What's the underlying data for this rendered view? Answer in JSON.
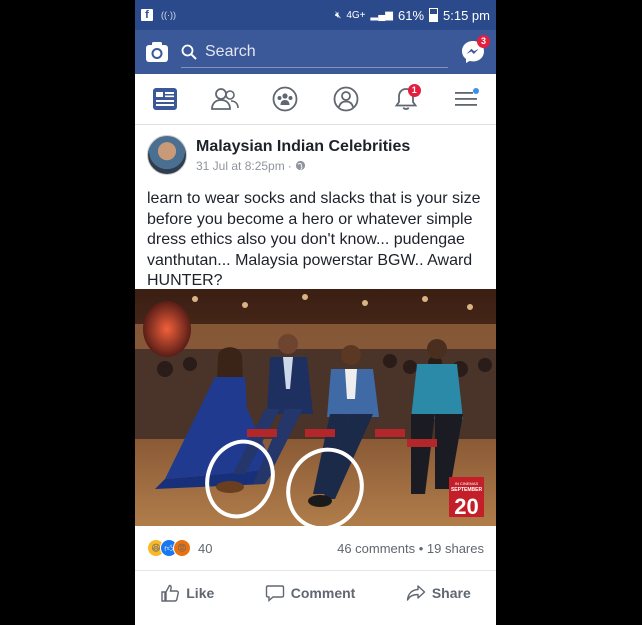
{
  "status_bar": {
    "network": "4G+",
    "battery": "61%",
    "time": "5:15 pm"
  },
  "topbar": {
    "search_placeholder": "Search",
    "messenger_badge": "3"
  },
  "nav": {
    "notifications_badge": "1"
  },
  "post": {
    "author": "Malaysian Indian Celebrities",
    "timestamp": "31 Jul at 8:25pm",
    "text": "learn to wear socks and slacks that is your size before you become a hero or whatever simple dress ethics also you don't know... pudengae vanthutan... Malaysia powerstar BGW.. Award HUNTER?",
    "image_overlay": {
      "small_text": "IN CINEMAS",
      "month": "SEPTEMBER",
      "day": "20"
    }
  },
  "stats": {
    "reaction_count": "40",
    "comments_shares": "46 comments • 19 shares"
  },
  "actions": {
    "like": "Like",
    "comment": "Comment",
    "share": "Share"
  },
  "colors": {
    "brand": "#3b5998",
    "badge": "#e41e3f",
    "annotation_circles": "#ffffff"
  }
}
